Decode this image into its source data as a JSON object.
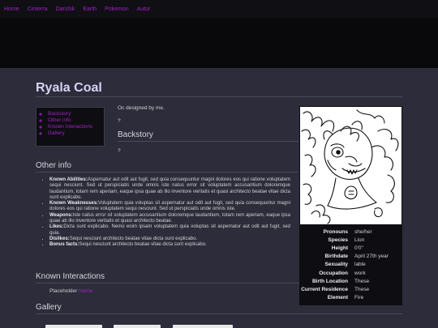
{
  "nav": {
    "items": [
      "Home",
      "Cinterra",
      "Darshik",
      "Earth",
      "Pokemon",
      "Autor"
    ]
  },
  "page": {
    "title": "Ryala Coal"
  },
  "toc": {
    "items": [
      "Backstory",
      "Other info",
      "Known Interactions",
      "Gallery"
    ]
  },
  "intro": {
    "text": "Oc designed by me.",
    "q1": "?"
  },
  "backstory": {
    "heading": "Backstory",
    "text": "?"
  },
  "other_info": {
    "heading": "Other info",
    "items": [
      {
        "label": "Known Abilities:",
        "text": "Aspernatur aut odit aut fugit, sed quia consequuntur magni dolores eos qui ratione voluptatem sequi nesciunt. Sed ut perspiciatis unde omnis iste natus error sit voluptatem accusantium doloremque laudantium, totam rem aperiam, eaque ipsa quae ab illo inventore veritatis et quasi architecto beatae vitae dicta sunt explicabo."
      },
      {
        "label": "Known Weaknesses:",
        "text": "Voluptatem quia voluptas sit aspernatur aut odit aut fugit, sed quia consequuntur magni dolores eos qui ratione voluptatem sequi nesciunt. Sed ut perspiciatis unde omnis iste."
      },
      {
        "label": "Weapons:",
        "text": "Iste natus error sit voluptatem accusantium doloremque laudantium, totam rem aperiam, eaque ipsa quae ab illo inventore veritatis et quasi architecto beatae."
      },
      {
        "label": "Likes:",
        "text": "Dicta sunt explicabo. Nemo enim ipsam voluptatem quia voluptas sit aspernatur aut odit aut fugit, sed quia."
      },
      {
        "label": "Dislikes:",
        "text": "Sequi nesciunt architecto beatae vitae dicta sunt explicabo."
      },
      {
        "label": "Bonus facts:",
        "text": "Sequi nesciunt architecto beatae vitae dicta sunt explicabo."
      }
    ]
  },
  "known_interactions": {
    "heading": "Known Interactions",
    "placeholder": "Placeholder",
    "link": "Name"
  },
  "gallery": {
    "heading": "Gallery"
  },
  "infobox": {
    "rows": [
      {
        "key": "Pronouns",
        "value": "she/her"
      },
      {
        "key": "Species",
        "value": "Lion"
      },
      {
        "key": "Height",
        "value": "0'0\""
      },
      {
        "key": "Birthdate",
        "value": "April 27th year"
      },
      {
        "key": "Sexuality",
        "value": "lable"
      },
      {
        "key": "Occupation",
        "value": "work"
      },
      {
        "key": "Birth Location",
        "value": "These"
      },
      {
        "key": "Current Residence",
        "value": "These"
      },
      {
        "key": "Element",
        "value": "Fire"
      }
    ]
  },
  "colors": {
    "link": "#a020c0",
    "background": "#2c2c3a",
    "nav_bg": "#0f0f14",
    "box_bg": "#0e0e12"
  }
}
